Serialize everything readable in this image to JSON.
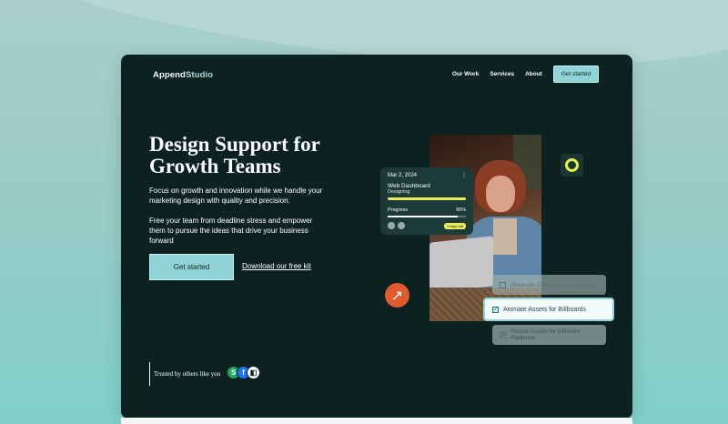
{
  "brand": {
    "name_part1": "Append",
    "name_part2": "Studio"
  },
  "nav": {
    "items": [
      "Our Work",
      "Services",
      "About"
    ],
    "cta": "Get started"
  },
  "hero": {
    "title": "Design Support for Growth Teams",
    "paragraph1": "Focus on growth and innovation while we handle your marketing design with quality and precision.",
    "paragraph2": "Free your team from deadline stress and empower them to pursue the ideas that drive your business forward",
    "primary_button": "Get started",
    "secondary_link": "Download our free kit"
  },
  "trusted": {
    "label": "Trusted by others like you",
    "badges": [
      "S",
      "f",
      "◧"
    ]
  },
  "dashboard_card": {
    "date": "Mar 2, 2024",
    "project": "Web Dashboard",
    "status": "Designing",
    "progress_label": "Progress",
    "progress_value": "90%",
    "progress_fraction": 0.9,
    "days_left": "3 days left"
  },
  "tasks": [
    {
      "label": "Generate Concepts for Campaign",
      "checked": false
    },
    {
      "label": "Animate Assets for Billboards",
      "checked": true
    },
    {
      "label": "Resize Assets for Different Platforms",
      "checked": true
    }
  ],
  "colors": {
    "background": "#0b2220",
    "accent": "#8fd4d8",
    "highlight": "#ecec5a",
    "orange": "#e15a2e"
  }
}
